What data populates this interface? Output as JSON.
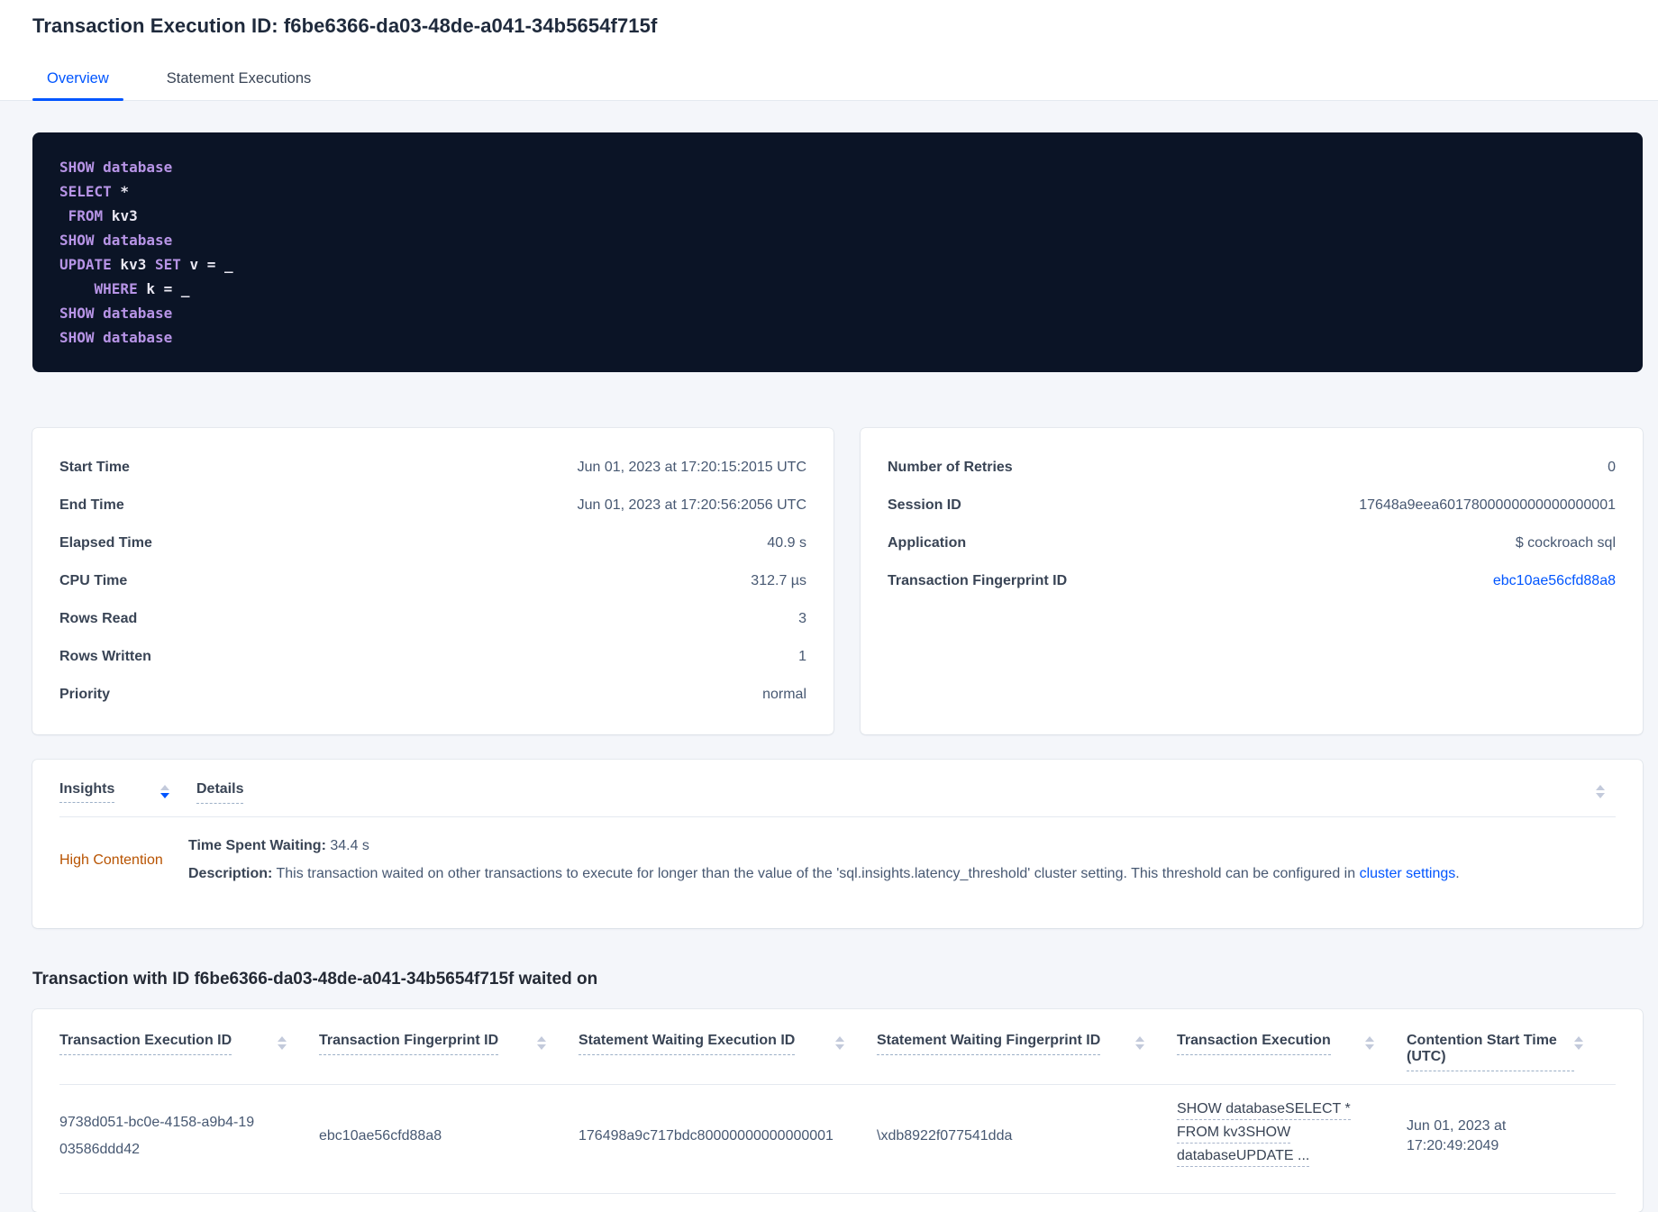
{
  "page": {
    "title": "Transaction Execution ID: f6be6366-da03-48de-a041-34b5654f715f"
  },
  "tabs": [
    {
      "label": "Overview"
    },
    {
      "label": "Statement Executions"
    }
  ],
  "colors": {
    "accent_blue": "#0055ff",
    "insight_orange": "#b85300",
    "code_background": "#0b1426",
    "code_keyword": "#b794e6",
    "code_plain": "#e9e7f2"
  },
  "sql_box": {
    "lines": [
      [
        {
          "c": "kw",
          "t": "SHOW"
        },
        {
          "c": "pl",
          "t": " "
        },
        {
          "c": "kw",
          "t": "database"
        }
      ],
      [
        {
          "c": "kw",
          "t": "SELECT"
        },
        {
          "c": "pl",
          "t": " *"
        }
      ],
      [
        {
          "c": "pl",
          "t": " "
        },
        {
          "c": "kw",
          "t": "FROM"
        },
        {
          "c": "pl",
          "t": " kv3"
        }
      ],
      [
        {
          "c": "kw",
          "t": "SHOW"
        },
        {
          "c": "pl",
          "t": " "
        },
        {
          "c": "kw",
          "t": "database"
        }
      ],
      [
        {
          "c": "kw",
          "t": "UPDATE"
        },
        {
          "c": "pl",
          "t": " kv3 "
        },
        {
          "c": "kw",
          "t": "SET"
        },
        {
          "c": "pl",
          "t": " v = _"
        }
      ],
      [
        {
          "c": "pl",
          "t": "    "
        },
        {
          "c": "kw",
          "t": "WHERE"
        },
        {
          "c": "pl",
          "t": " k = _"
        }
      ],
      [
        {
          "c": "kw",
          "t": "SHOW"
        },
        {
          "c": "pl",
          "t": " "
        },
        {
          "c": "kw",
          "t": "database"
        }
      ],
      [
        {
          "c": "kw",
          "t": "SHOW"
        },
        {
          "c": "pl",
          "t": " "
        },
        {
          "c": "kw",
          "t": "database"
        }
      ]
    ]
  },
  "summary_left": {
    "rows": [
      {
        "label": "Start Time",
        "value": "Jun 01, 2023 at 17:20:15:2015 UTC"
      },
      {
        "label": "End Time",
        "value": "Jun 01, 2023 at 17:20:56:2056 UTC"
      },
      {
        "label": "Elapsed Time",
        "value": "40.9 s"
      },
      {
        "label": "CPU Time",
        "value": "312.7 µs"
      },
      {
        "label": "Rows Read",
        "value": "3"
      },
      {
        "label": "Rows Written",
        "value": "1"
      },
      {
        "label": "Priority",
        "value": "normal"
      }
    ]
  },
  "summary_right": {
    "rows": [
      {
        "label": "Number of Retries",
        "value": "0"
      },
      {
        "label": "Session ID",
        "value": "17648a9eea6017800000000000000001"
      },
      {
        "label": "Application",
        "value": "$ cockroach sql"
      },
      {
        "label": "Transaction Fingerprint ID",
        "value": "ebc10ae56cfd88a8"
      }
    ]
  },
  "insights_table": {
    "col_insights": "Insights",
    "col_details": "Details",
    "row": {
      "insight": "High Contention",
      "waiting_label": "Time Spent Waiting:",
      "waiting_value": " 34.4 s",
      "description_label": "Description:",
      "description_text": " This transaction waited on other transactions to execute for longer than the value of the 'sql.insights.latency_threshold' cluster setting. This threshold can be configured in ",
      "description_link": "cluster settings",
      "description_suffix": "."
    }
  },
  "waited_on": {
    "heading": "Transaction with ID f6be6366-da03-48de-a041-34b5654f715f waited on",
    "columns": [
      "Transaction Execution ID",
      "Transaction Fingerprint ID",
      "Statement Waiting Execution ID",
      "Statement Waiting Fingerprint ID",
      "Transaction Execution",
      "Contention Start Time (UTC)"
    ],
    "row": {
      "txn_execution_id": "9738d051-bc0e-4158-a9b4-1903586ddd42",
      "txn_fingerprint_id": "ebc10ae56cfd88a8",
      "stmt_waiting_execution_id": "176498a9c717bdc80000000000000001",
      "stmt_waiting_fingerprint_id": "\\xdb8922f077541dda",
      "txn_execution_lines": [
        "SHOW databaseSELECT *",
        "FROM kv3SHOW",
        "databaseUPDATE ..."
      ],
      "contention_start": "Jun 01, 2023 at 17:20:49:2049"
    }
  }
}
